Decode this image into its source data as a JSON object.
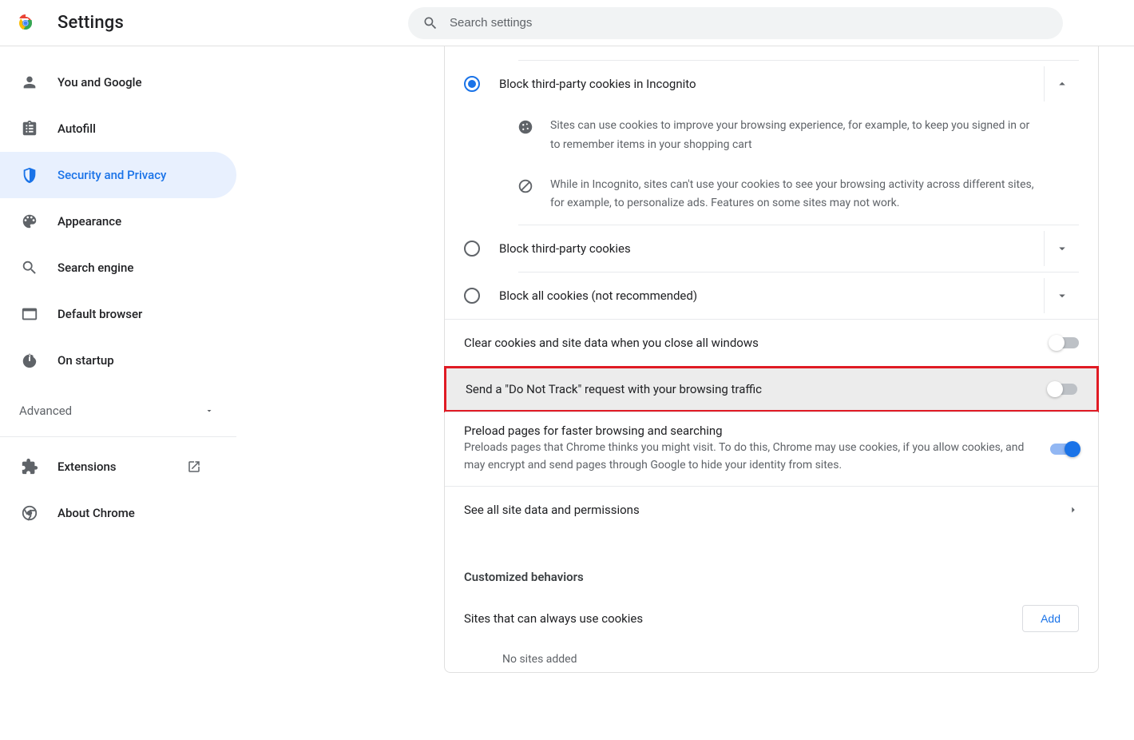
{
  "header": {
    "title": "Settings",
    "searchPlaceholder": "Search settings"
  },
  "sidebar": {
    "items": [
      {
        "key": "you",
        "label": "You and Google",
        "icon": "person"
      },
      {
        "key": "autofill",
        "label": "Autofill",
        "icon": "clipboard"
      },
      {
        "key": "security",
        "label": "Security and Privacy",
        "icon": "shield",
        "active": true
      },
      {
        "key": "appearance",
        "label": "Appearance",
        "icon": "palette"
      },
      {
        "key": "search",
        "label": "Search engine",
        "icon": "search"
      },
      {
        "key": "default",
        "label": "Default browser",
        "icon": "browser"
      },
      {
        "key": "startup",
        "label": "On startup",
        "icon": "power"
      }
    ],
    "advanced": "Advanced",
    "extensions": "Extensions",
    "about": "About Chrome"
  },
  "main": {
    "radio1": {
      "label": "Block third-party cookies in Incognito",
      "desc1": "Sites can use cookies to improve your browsing experience, for example, to keep you signed in or to remember items in your shopping cart",
      "desc2": "While in Incognito, sites can't use your cookies to see your browsing activity across different sites, for example, to personalize ads. Features on some sites may not work."
    },
    "radio2": {
      "label": "Block third-party cookies"
    },
    "radio3": {
      "label": "Block all cookies (not recommended)"
    },
    "toggle1": {
      "title": "Clear cookies and site data when you close all windows",
      "on": false
    },
    "toggle2": {
      "title": "Send a \"Do Not Track\" request with your browsing traffic",
      "on": false
    },
    "toggle3": {
      "title": "Preload pages for faster browsing and searching",
      "sub": "Preloads pages that Chrome thinks you might visit. To do this, Chrome may use cookies, if you allow cookies, and may encrypt and send pages through Google to hide your identity from sites.",
      "on": true
    },
    "allSites": "See all site data and permissions",
    "customized": "Customized behaviors",
    "alwaysCookies": "Sites that can always use cookies",
    "add": "Add",
    "noSites": "No sites added"
  }
}
